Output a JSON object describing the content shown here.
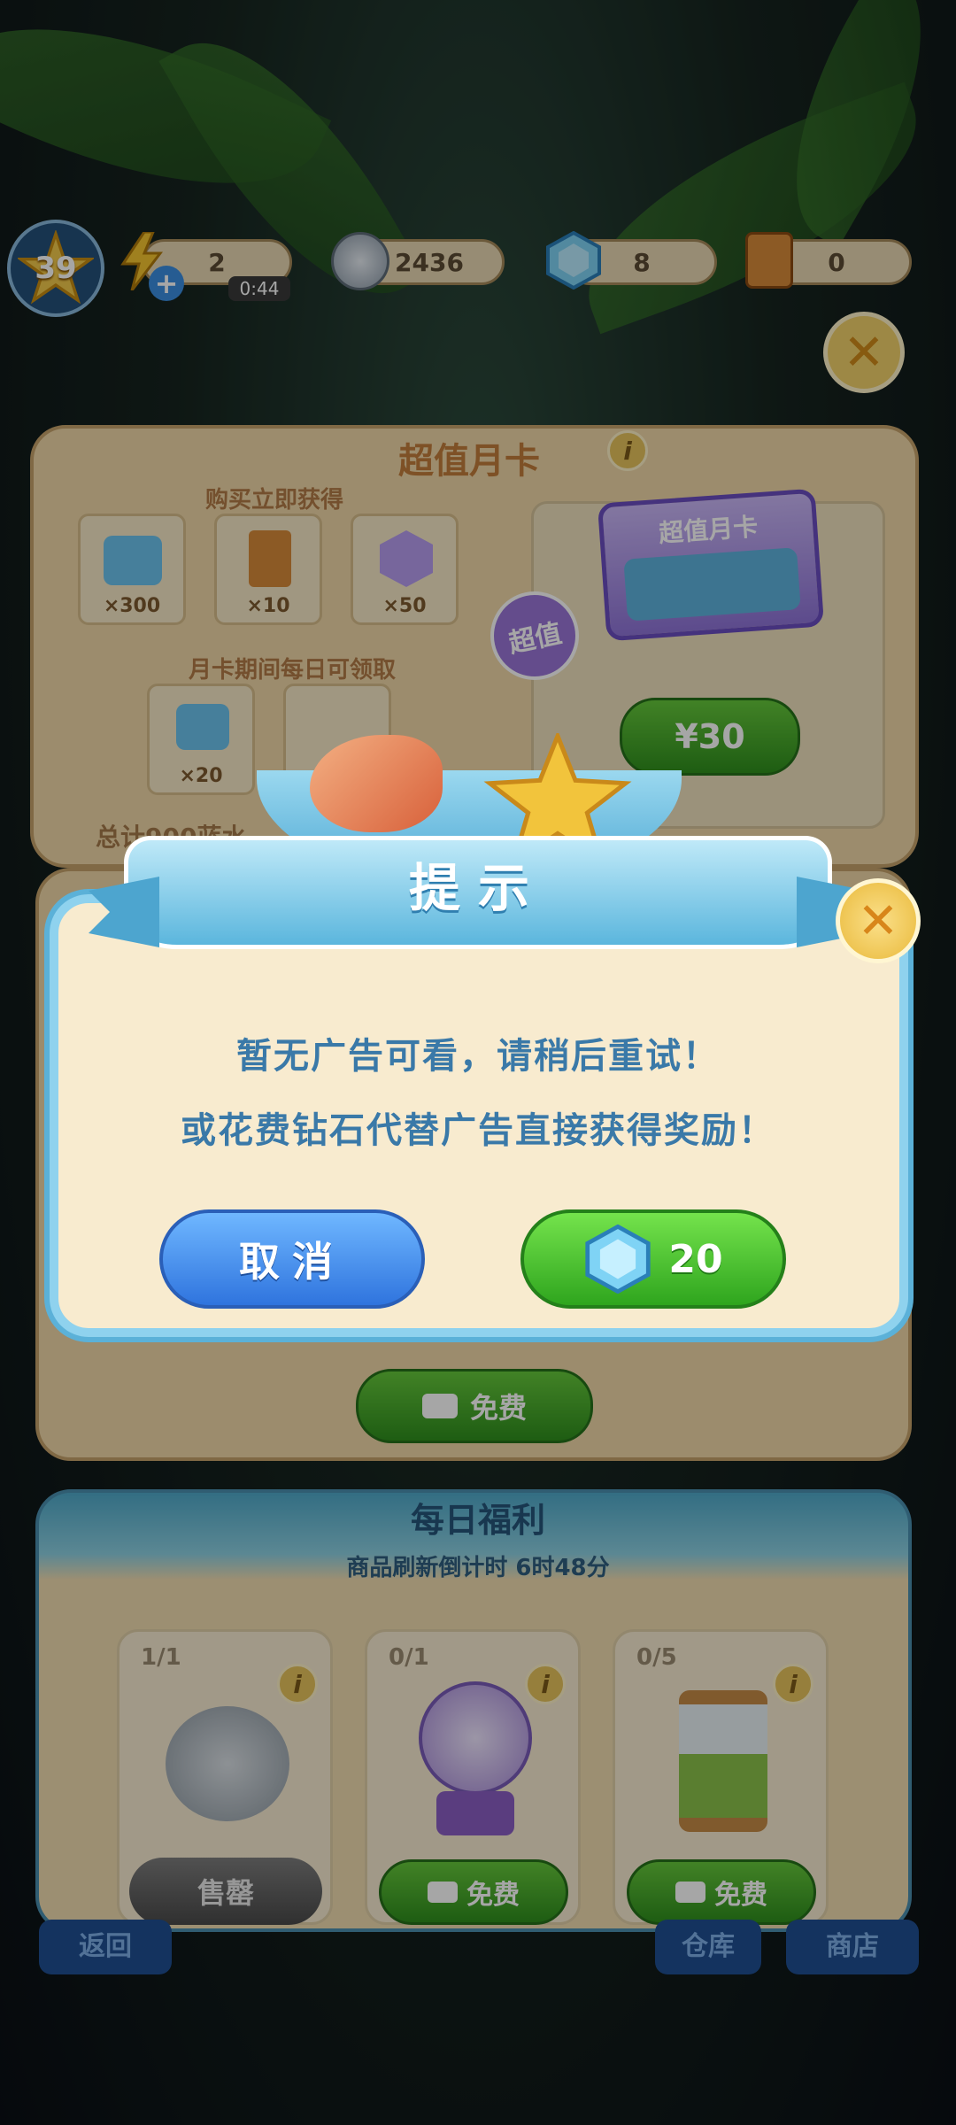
{
  "topbar": {
    "level": "39",
    "energy_value": "2",
    "energy_timer": "0:44",
    "coins": "2436",
    "gems": "8",
    "cards": "0"
  },
  "monthly_card": {
    "title": "超值月卡",
    "buy_label": "购买立即获得",
    "items": [
      {
        "qty": "×300"
      },
      {
        "qty": "×10"
      },
      {
        "qty": "×50"
      }
    ],
    "daily_label": "月卡期间每日可领取",
    "daily_items": [
      {
        "qty": "×20"
      }
    ],
    "total_label": "总计900蓝水",
    "card_title": "超值月卡",
    "badge": "超值",
    "price": "¥30"
  },
  "free_button": "免费",
  "dialog": {
    "title": "提示",
    "line1": "暂无广告可看，请稍后重试！",
    "line2": "或花费钻石代替广告直接获得奖励！",
    "cancel": "取消",
    "diamond_cost": "20"
  },
  "daily": {
    "title": "每日福利",
    "subtitle": "商品刷新倒计时  6时48分",
    "cards": [
      {
        "count": "1/1",
        "button": "售罄"
      },
      {
        "count": "0/1",
        "button": "免费"
      },
      {
        "count": "0/5",
        "button": "免费"
      }
    ]
  },
  "bottom_nav": {
    "back": "返回",
    "warehouse": "仓库",
    "shop": "商店"
  },
  "colors": {
    "dialog_text": "#3a79a8",
    "green": "#3aa327",
    "blue": "#3d8fe8"
  }
}
